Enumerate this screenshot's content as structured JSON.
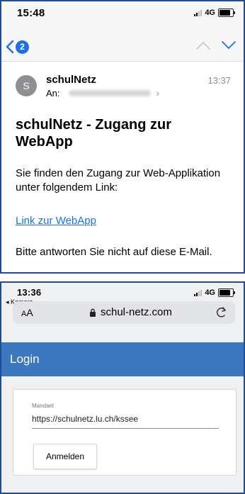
{
  "mail_screen": {
    "status": {
      "time": "15:48",
      "network": "4G"
    },
    "nav": {
      "back_badge": "2"
    },
    "sender_initial": "S",
    "sender": "schulNetz",
    "received_time": "13:37",
    "to_label": "An:",
    "subject": "schulNetz - Zugang zur WebApp",
    "body_text": "Sie finden den Zugang zur Web-Applikation unter folgendem Link:",
    "link_text": "Link zur WebApp",
    "footer_text": "Bitte antworten Sie nicht auf diese E-Mail."
  },
  "browser_screen": {
    "status": {
      "time": "13:36",
      "back_app": "◂ Kamera",
      "network": "4G"
    },
    "text_size_label": {
      "small": "A",
      "large": "A"
    },
    "url": "schul-netz.com",
    "login_title": "Login",
    "form": {
      "field_label": "Mandant",
      "field_value": "https://schulnetz.lu.ch/kssee",
      "button_label": "Anmelden"
    }
  },
  "colors": {
    "accent": "#1a73e8",
    "login_bar": "#3c78c0",
    "frame": "#1f4e96"
  }
}
